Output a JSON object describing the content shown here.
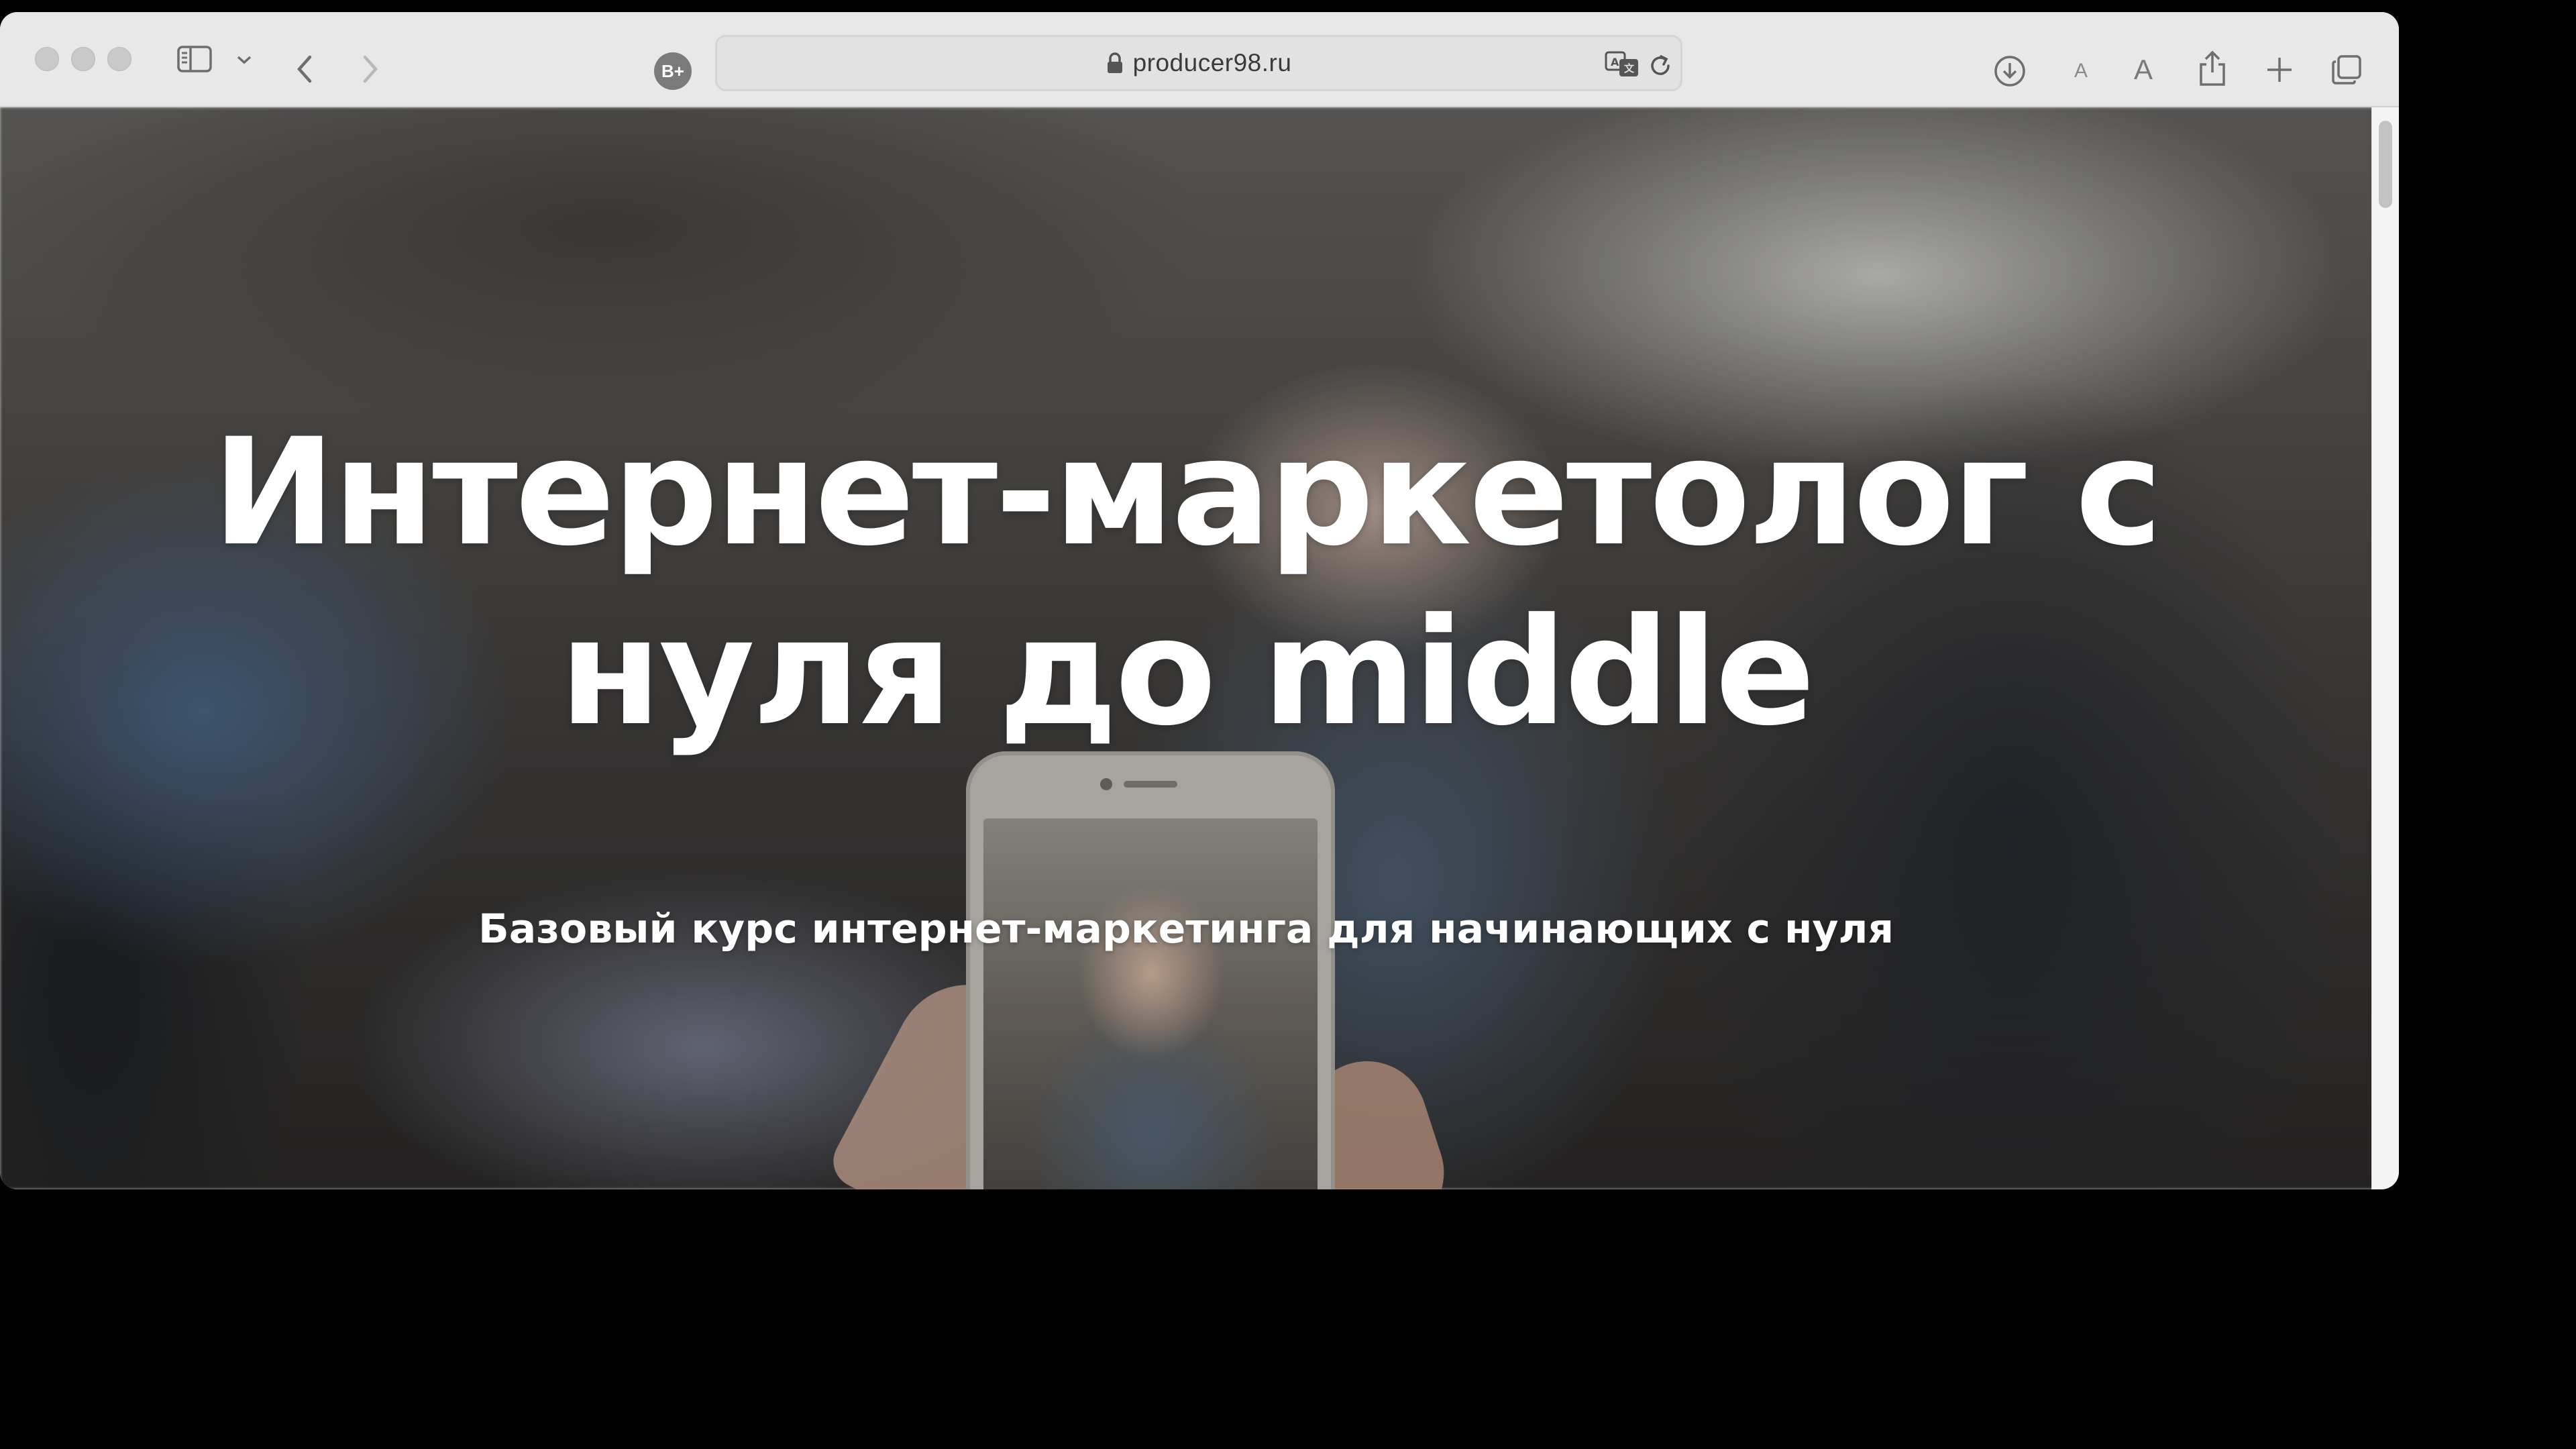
{
  "browser": {
    "profile_badge": "B+",
    "address_bar": {
      "url": "producer98.ru",
      "secure": true
    },
    "toolbar_icons": {
      "sidebar": "sidebar-icon",
      "back": "chevron-left-icon",
      "forward": "chevron-right-icon",
      "translate": "translate-icon",
      "reload": "reload-icon",
      "downloads": "download-icon",
      "text_smaller": "A",
      "text_larger": "A",
      "share": "share-icon",
      "new_tab": "plus-icon",
      "tab_overview": "tabs-icon"
    }
  },
  "hero": {
    "title_line1": "Интернет-маркетолог с",
    "title_line2": "нуля до middle",
    "subtitle": "Базовый курс интернет-маркетинга для начинающих с нуля"
  },
  "colors": {
    "toolbar_bg": "#e9e8e8",
    "hero_text": "#ffffff",
    "outer_bg": "#000000"
  }
}
